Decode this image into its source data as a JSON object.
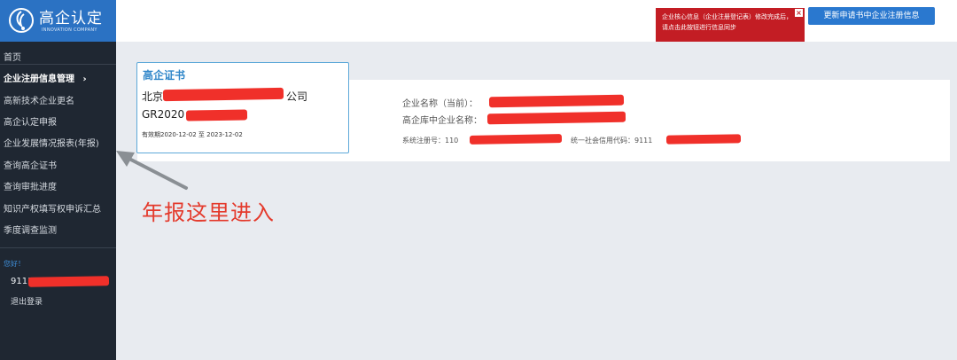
{
  "logo": {
    "title": "高企认定",
    "subtitle": "INNOVATION COMPANY"
  },
  "sidebar": {
    "items": [
      {
        "label": "首页"
      },
      {
        "label": "企业注册信息管理",
        "arrow": "›"
      },
      {
        "label": "高新技术企业更名"
      },
      {
        "label": "高企认定申报"
      },
      {
        "label": "企业发展情况报表(年报)"
      },
      {
        "label": "查询高企证书"
      },
      {
        "label": "查询审批进度"
      },
      {
        "label": "知识产权填写权申诉汇总"
      },
      {
        "label": "季度调查监测"
      }
    ],
    "greeting": "您好！",
    "user_id": "9111",
    "logout": "退出登录"
  },
  "header": {
    "alert_text": "企业核心信息（企业注册登记表）修改完成后，请点击此按钮进行信息同步",
    "alert_close": "×",
    "update_button": "更新申请书中企业注册信息"
  },
  "certificate": {
    "title": "高企证书",
    "name_prefix": "北京",
    "name_suffix": "公司",
    "number_prefix": "GR2020",
    "validity": "有效期2020-12-02 至 2023-12-02"
  },
  "company": {
    "name_label": "企业名称（当前）：",
    "db_name_label": "高企库中企业名称：",
    "reg_no_label": "系统注册号：110",
    "credit_code_label": "统一社会信用代码：9111"
  },
  "annotation": {
    "text": "年报这里进入"
  },
  "colors": {
    "accent": "#2b72c3",
    "alert": "#c31d24",
    "annotation": "#e43a2c",
    "sidebar": "#1f2732"
  }
}
